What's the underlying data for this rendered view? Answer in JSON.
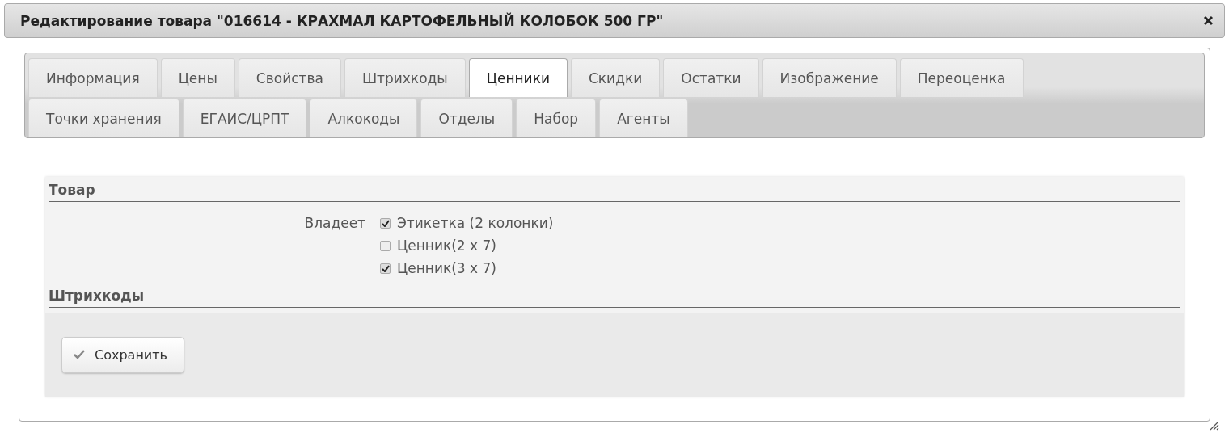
{
  "window": {
    "title": "Редактирование товара \"016614 - КРАХМАЛ КАРТОФЕЛЬНЫЙ КОЛОБОК 500 ГР\""
  },
  "tab_rows": [
    {
      "tabs": [
        {
          "label": "Информация",
          "selected": false
        },
        {
          "label": "Цены",
          "selected": false
        },
        {
          "label": "Свойства",
          "selected": false
        },
        {
          "label": "Штрихкоды",
          "selected": false
        },
        {
          "label": "Ценники",
          "selected": true
        },
        {
          "label": "Скидки",
          "selected": false
        },
        {
          "label": "Остатки",
          "selected": false
        },
        {
          "label": "Изображение",
          "selected": false
        },
        {
          "label": "Переоценка",
          "selected": false
        }
      ]
    },
    {
      "tabs": [
        {
          "label": "Точки хранения",
          "selected": false
        },
        {
          "label": "ЕГАИС/ЦРПТ",
          "selected": false
        },
        {
          "label": "Алкокоды",
          "selected": false
        },
        {
          "label": "Отделы",
          "selected": false
        },
        {
          "label": "Набор",
          "selected": false
        },
        {
          "label": "Агенты",
          "selected": false
        }
      ]
    }
  ],
  "sections": [
    {
      "title": "Товар",
      "field_label": "Владеет",
      "options": [
        {
          "label": "Этикетка (2 колонки)",
          "checked": true
        },
        {
          "label": "Ценник(2 x 7)",
          "checked": false
        },
        {
          "label": "Ценник(3 x 7)",
          "checked": true
        }
      ]
    },
    {
      "title": "Штрихкоды"
    }
  ],
  "save_button": {
    "label": "Сохранить"
  }
}
